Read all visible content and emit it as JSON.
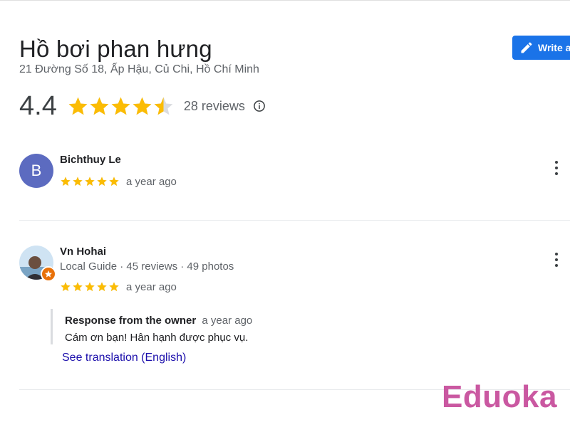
{
  "place": {
    "title": "Hồ bơi phan hưng",
    "address": "21 Đường Số 18, Ấp Hậu, Củ Chi, Hồ Chí Minh",
    "rating": "4.4",
    "rating_value": 4.4,
    "review_count": "28 reviews",
    "write_button": "Write a review"
  },
  "colors": {
    "star": "#fbbc04",
    "star_empty": "#dadce0",
    "primary": "#1a73e8",
    "link": "#1a0dab",
    "avatar_bg": "#5c6bc0",
    "badge": "#e8710a"
  },
  "reviews": [
    {
      "avatar_letter": "B",
      "name": "Bichthuy Le",
      "meta": "",
      "stars": 5,
      "time": "a year ago"
    },
    {
      "avatar_letter": "",
      "name": "Vn Hohai",
      "meta": "Local Guide · 45 reviews · 49 photos",
      "stars": 5,
      "time": "a year ago",
      "owner_response": {
        "label": "Response from the owner",
        "time": "a year ago",
        "text": "Cám ơn bạn! Hân hạnh được phục vụ."
      },
      "translation_link": "See translation (English)"
    }
  ],
  "watermark": "Eduoka"
}
